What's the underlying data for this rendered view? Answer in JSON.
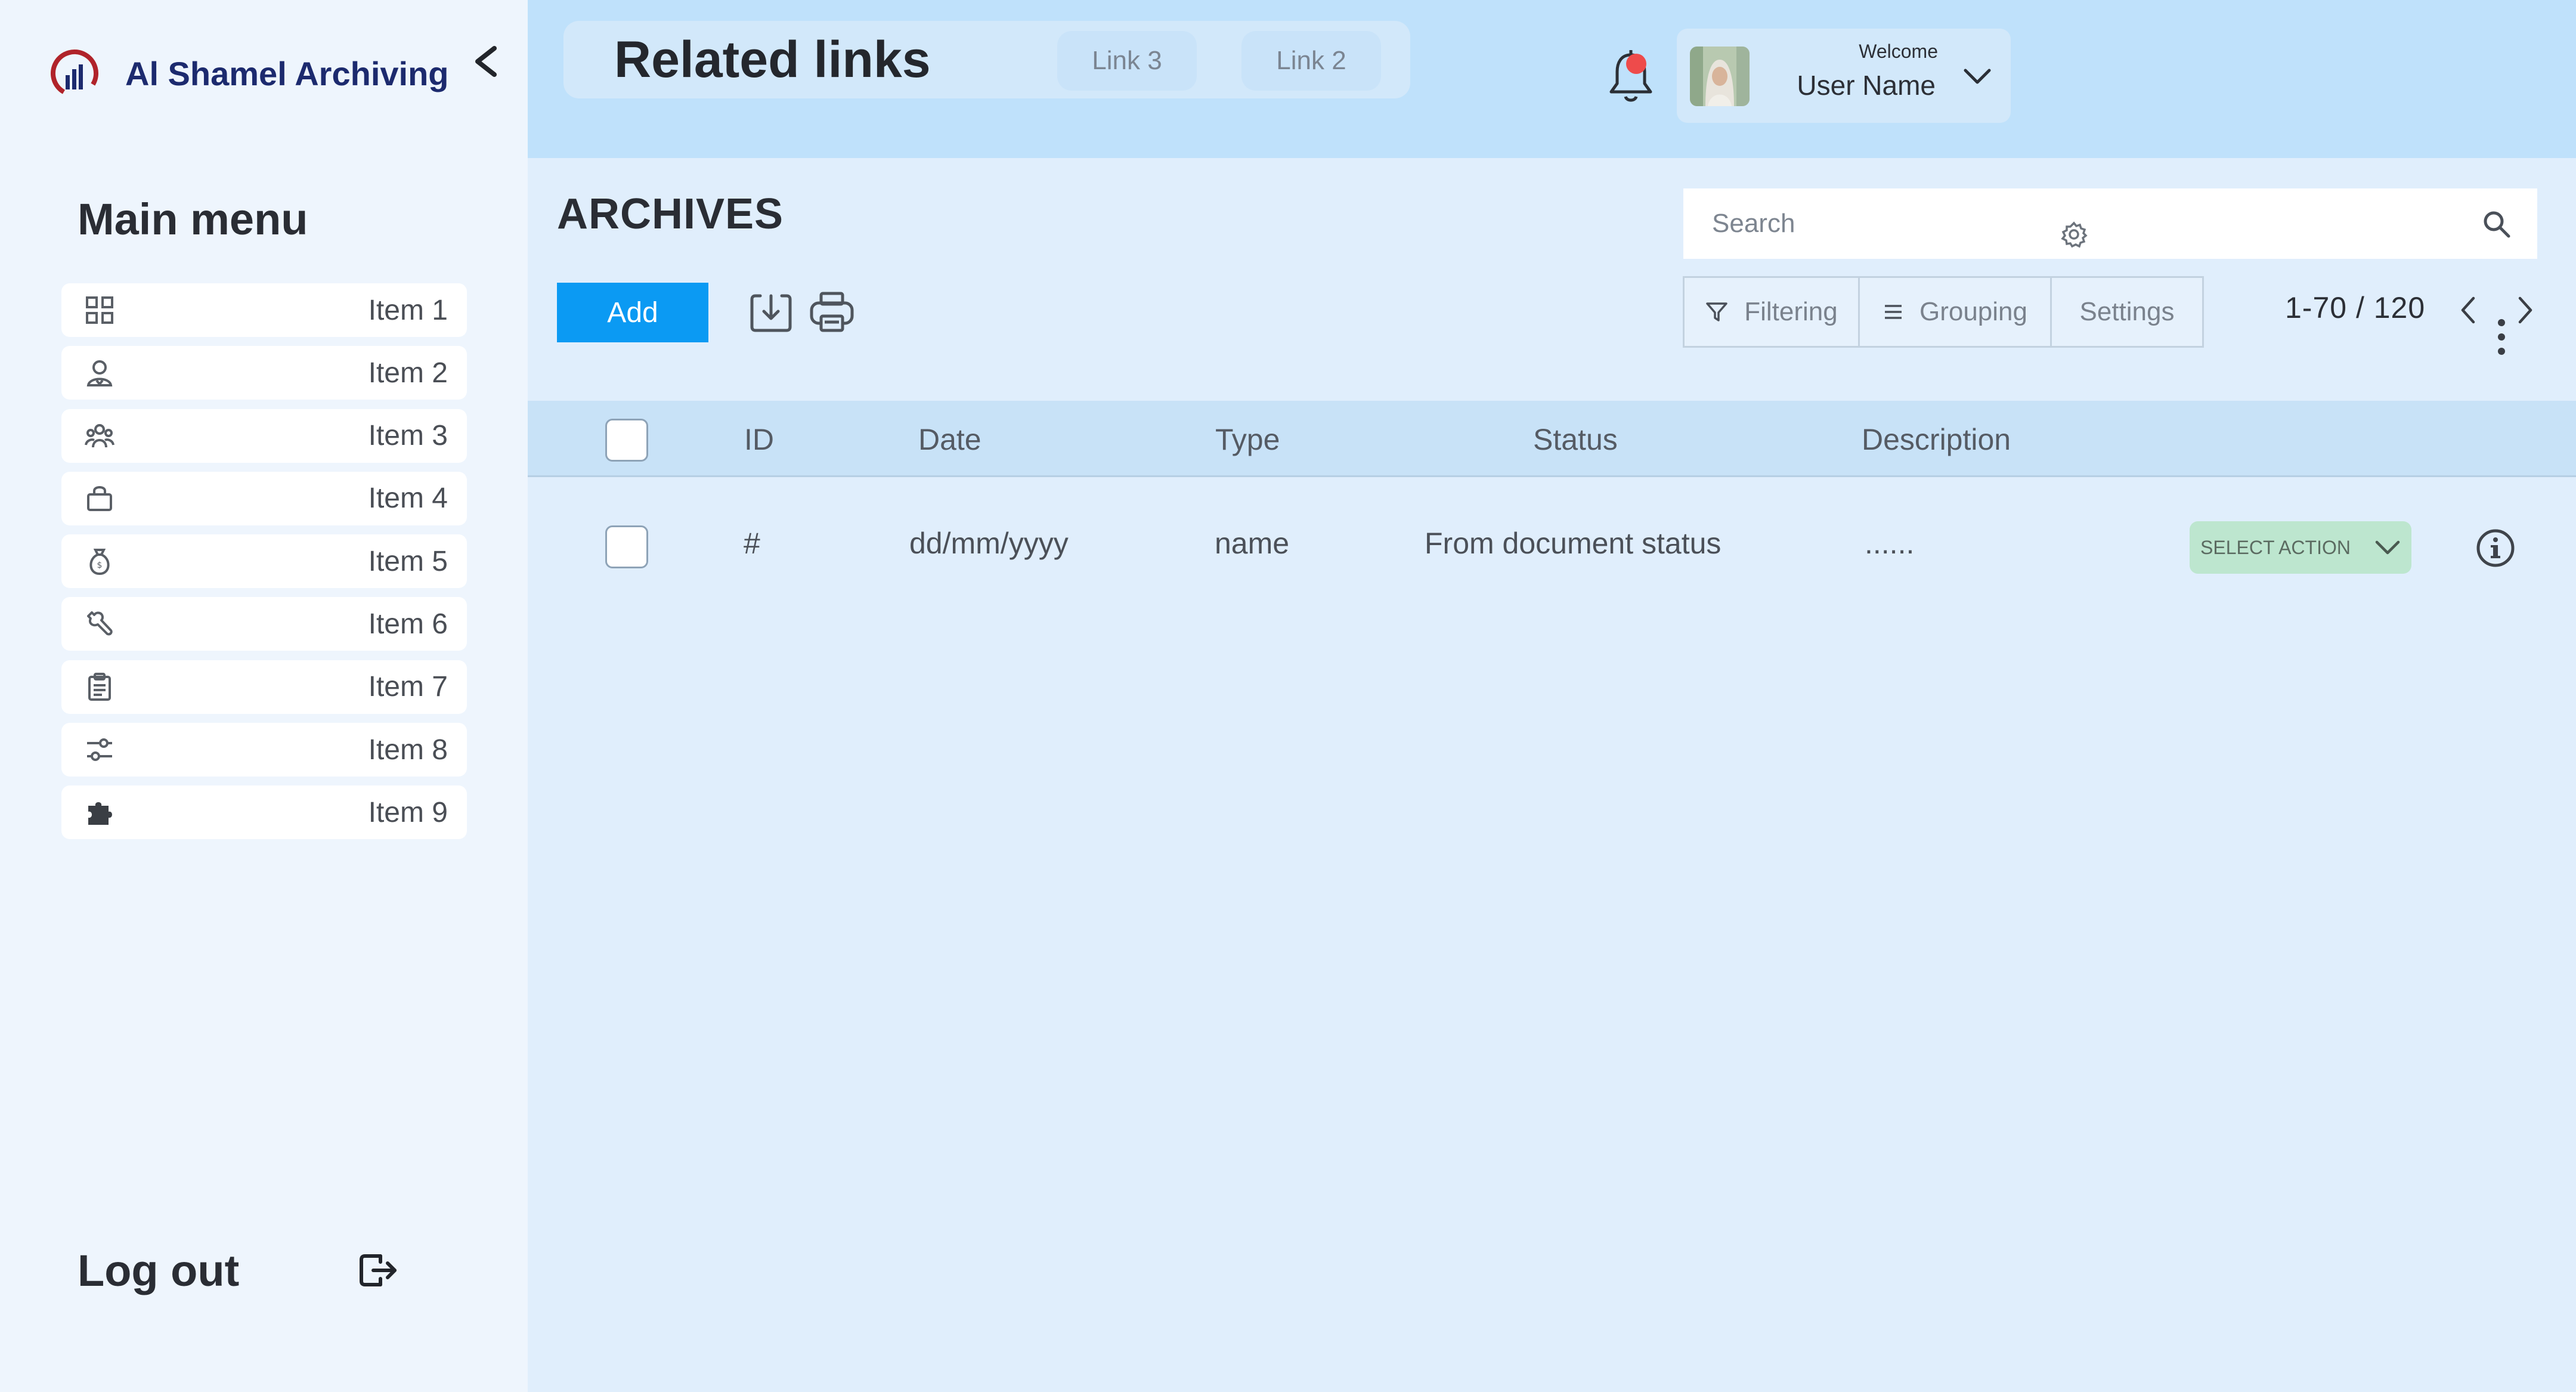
{
  "brand": {
    "name": "Al Shamel Archiving",
    "accent": "#1c2a6e",
    "logo_color": "#b0232a"
  },
  "sidebar": {
    "title": "Main menu",
    "items": [
      {
        "label": "Item 1",
        "icon": "grid-icon"
      },
      {
        "label": "Item 2",
        "icon": "user-icon"
      },
      {
        "label": "Item 3",
        "icon": "group-icon"
      },
      {
        "label": "Item 4",
        "icon": "basket-icon"
      },
      {
        "label": "Item 5",
        "icon": "money-bag-icon"
      },
      {
        "label": "Item 6",
        "icon": "wrench-icon"
      },
      {
        "label": "Item 7",
        "icon": "clipboard-icon"
      },
      {
        "label": "Item 8",
        "icon": "sliders-icon"
      },
      {
        "label": "Item 9",
        "icon": "puzzle-icon"
      }
    ],
    "logout_label": "Log out"
  },
  "header": {
    "title": "Related links",
    "links": [
      "Link 3",
      "Link 2"
    ],
    "user": {
      "welcome": "Welcome",
      "name": "User Name"
    },
    "notification_color": "#ee4b4b"
  },
  "main": {
    "title": "ARCHIVES",
    "search": {
      "placeholder": "Search"
    },
    "add_label": "Add",
    "tools": {
      "filtering": "Filtering",
      "grouping": "Grouping",
      "settings": "Settings"
    },
    "pagination": {
      "text": "1-70  /  120"
    },
    "primary_color": "#0b9af3"
  },
  "table": {
    "columns": [
      "ID",
      "Date",
      "Type",
      "Status",
      "Description"
    ],
    "rows": [
      {
        "id": "#",
        "date": "dd/mm/yyyy",
        "type": "name",
        "status": "From document status",
        "description": "......",
        "action": "SELECT ACTION"
      }
    ]
  }
}
